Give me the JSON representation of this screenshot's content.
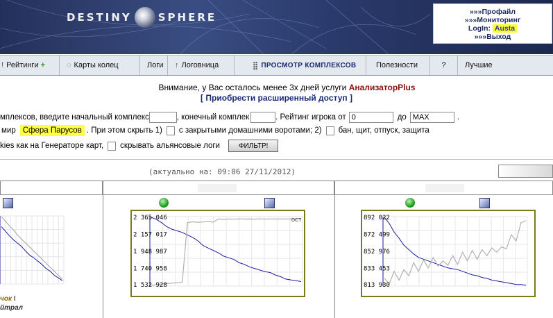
{
  "header": {
    "logo_left": "DESTINY",
    "logo_right": "SPHERE",
    "links": {
      "profile": "»»»Профайл",
      "monitoring": "»»»Мониторинг",
      "login_label": "LogIn:",
      "login_user": "Austa",
      "logout": "»»»Выход"
    }
  },
  "nav": {
    "items": [
      {
        "label": "Рейтинги",
        "extra": "+"
      },
      {
        "label": "Карты колец"
      },
      {
        "label": "Логи"
      },
      {
        "label": "Логовница"
      },
      {
        "label": "ПРОСМОТР КОМПЛЕКСОВ"
      },
      {
        "label": "Полезности"
      },
      {
        "label": "?"
      },
      {
        "label": "Лучшие"
      }
    ]
  },
  "notice": {
    "text": "Внимание, у Вас осталось менее 3х дней услуги",
    "product": "АнализаторPlus",
    "link": "[ Приобрести расширенный доступ ]"
  },
  "filter": {
    "row1_start": "мплексов, введите начальный комплекс",
    "row1_end_label": ", конечный комплек",
    "row1_rating": ". Рейтинг игрока от",
    "rating_from": "0",
    "to_label": "до",
    "rating_to": "MAX",
    "dot": ".",
    "row2_start": "мир",
    "world": "Сфера Парусов",
    "row2_hide": ". При этом скрыть 1)",
    "opt1": "с закрытыми домашними воротами; 2)",
    "opt2": "бан, щит, отпуск, защита",
    "row3_start": "kies как на Генераторе карт,",
    "opt3": "скрывать альянсовые логи",
    "button": "ФИЛЬТР!"
  },
  "status": {
    "actual": "(актуально на: 09:06 27/11/2012)"
  },
  "columns": [
    {
      "captions": [
        "чок",
        "I",
        "йтрал"
      ]
    },
    {
      "y_ticks": [
        "2 365 046",
        "2 157 017",
        "1 948 987",
        "1 740 958",
        "1 532 928"
      ],
      "right_label": "DCT"
    },
    {
      "y_ticks": [
        "892 022",
        "872 499",
        "852 976",
        "833 453",
        "813 930"
      ]
    }
  ],
  "colors": {
    "series_main": "#1a1aa0",
    "series_ref": "#b0b0b0",
    "chart_border": "#7a7a1a",
    "highlight": "#ffff44"
  },
  "chart_data": [
    {
      "type": "line",
      "series": [
        {
          "values": [
            1.0,
            0.93,
            0.86,
            0.8,
            0.72,
            0.66,
            0.6,
            0.54,
            0.48,
            0.42,
            0.36,
            0.3,
            0.24,
            0.18,
            0.12,
            0.06
          ]
        },
        {
          "values": [
            0.85,
            0.78,
            0.71,
            0.65,
            0.6,
            0.55,
            0.48,
            0.42,
            0.38,
            0.33,
            0.28,
            0.22,
            0.18,
            0.12,
            0.08,
            0.04
          ]
        }
      ]
    },
    {
      "type": "line",
      "ylim": [
        1532928,
        2365046
      ],
      "y_ticks": [
        2365046,
        2157017,
        1948987,
        1740958,
        1532928
      ],
      "series": [
        {
          "values": [
            1532928,
            1540000,
            1548000,
            1555000,
            1560000,
            1565000,
            1570000,
            2300000,
            2310000,
            2305000,
            2308000,
            2312000,
            2306000,
            2345000,
            2340000,
            2345000,
            2342000,
            2346000,
            2344000,
            2345000,
            2343000,
            2346000,
            2344000,
            2345000,
            2345000,
            2345000,
            2345000,
            2345000,
            2345000,
            2345000
          ]
        },
        {
          "values": [
            2365046,
            2340000,
            2300000,
            2250000,
            2220000,
            2200000,
            2180000,
            2150000,
            2120000,
            2080000,
            2020000,
            1990000,
            1960000,
            1930000,
            1890000,
            1870000,
            1850000,
            1810000,
            1790000,
            1760000,
            1740000,
            1720000,
            1700000,
            1690000,
            1660000,
            1640000,
            1610000,
            1600000,
            1590000,
            1580000
          ]
        }
      ]
    },
    {
      "type": "line",
      "ylim": [
        813930,
        892022
      ],
      "y_ticks": [
        892022,
        872499,
        852976,
        833453,
        813930
      ],
      "series": [
        {
          "values": [
            822000,
            816000,
            830000,
            820000,
            832000,
            825000,
            840000,
            830000,
            843000,
            834000,
            846000,
            836000,
            842000,
            837000,
            848000,
            838000,
            852000,
            842000,
            854000,
            844000,
            855000,
            848000,
            857000,
            852000,
            858000,
            856000,
            872000,
            865000,
            886000,
            888000
          ]
        },
        {
          "values": [
            892022,
            885000,
            875000,
            868000,
            860000,
            855000,
            850000,
            846000,
            844000,
            842000,
            840000,
            838000,
            836000,
            834000,
            833000,
            832000,
            830000,
            828000,
            826000,
            825000,
            823000,
            822000,
            820000,
            819000,
            818000,
            817000,
            816000,
            815000,
            815000,
            814000
          ]
        }
      ]
    }
  ]
}
